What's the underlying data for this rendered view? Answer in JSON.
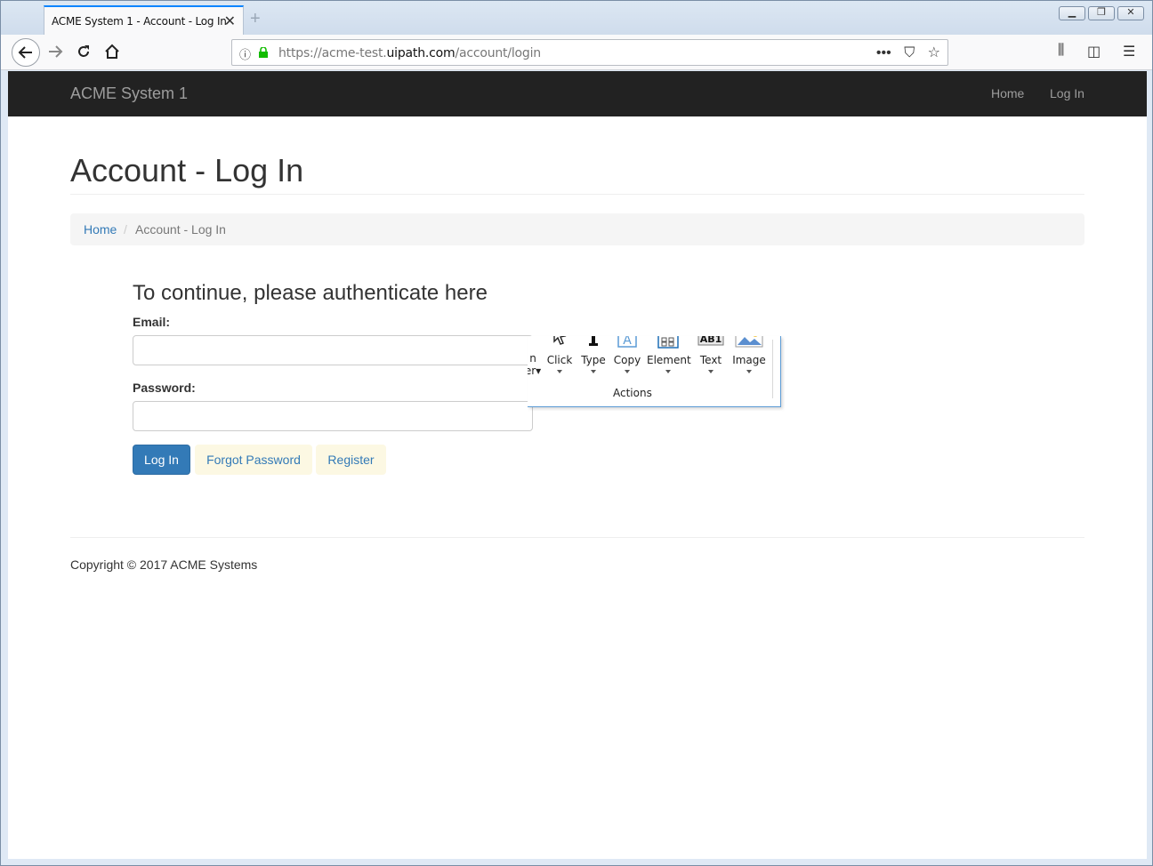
{
  "browser": {
    "tab_title": "ACME System 1 - Account - Log In",
    "url_prefix": "https://acme-test.",
    "url_domain": "uipath.com",
    "url_path": "/account/login",
    "accent": "#0a84ff"
  },
  "site": {
    "brand": "ACME System 1",
    "nav": [
      "Home",
      "Log In"
    ],
    "navbar_color": "#222222"
  },
  "page": {
    "title": "Account - Log In",
    "breadcrumb": {
      "home": "Home",
      "separator": "/",
      "current": "Account - Log In"
    },
    "form_heading": "To continue, please authenticate here",
    "email_label": "Email:",
    "email_value": "",
    "password_label": "Password:",
    "password_value": "",
    "login_button": "Log In",
    "forgot_button": "Forgot Password",
    "register_button": "Register",
    "footer": "Copyright © 2017 ACME Systems",
    "primary_color": "#337ab7"
  },
  "ribbon": {
    "items": [
      {
        "label": "Click",
        "icon": "cursor-icon"
      },
      {
        "label": "Type",
        "icon": "text-cursor-icon"
      },
      {
        "label": "Copy",
        "icon": "copy-text-icon"
      },
      {
        "label": "Element",
        "icon": "element-grid-icon"
      },
      {
        "label": "Text",
        "icon": "text-ocr-icon"
      },
      {
        "label": "Image",
        "icon": "image-icon"
      }
    ],
    "group_label": "Actions"
  }
}
